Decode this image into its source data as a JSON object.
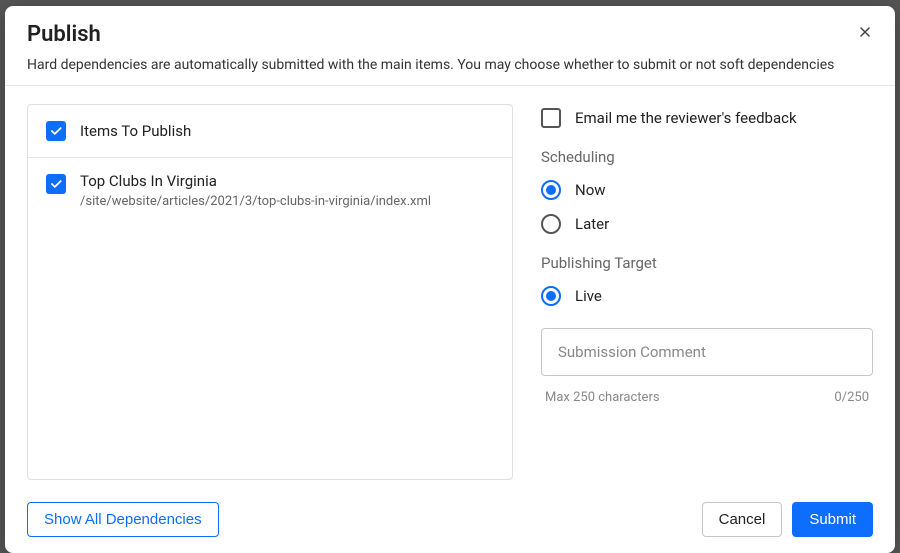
{
  "dialog": {
    "title": "Publish",
    "subtitle": "Hard dependencies are automatically submitted with the main items. You may choose whether to submit or not soft dependencies"
  },
  "items_panel": {
    "header_label": "Items To Publish",
    "rows": [
      {
        "title": "Top Clubs In Virginia",
        "path": "/site/website/articles/2021/3/top-clubs-in-virginia/index.xml"
      }
    ]
  },
  "options": {
    "email_feedback_label": "Email me the reviewer's feedback",
    "scheduling_label": "Scheduling",
    "now_label": "Now",
    "later_label": "Later",
    "publishing_target_label": "Publishing Target",
    "live_label": "Live",
    "comment_placeholder": "Submission Comment",
    "max_chars_label": "Max 250 characters",
    "char_counter": "0/250"
  },
  "footer": {
    "show_deps_label": "Show All Dependencies",
    "cancel_label": "Cancel",
    "submit_label": "Submit"
  }
}
